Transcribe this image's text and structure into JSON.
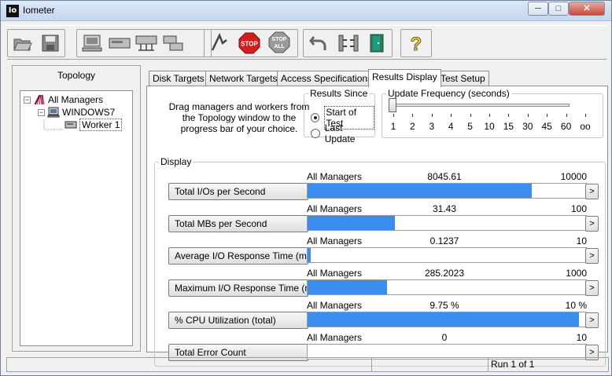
{
  "window": {
    "title": "Iometer",
    "icon": "io-app-icon",
    "min_label": "─",
    "max_label": "□",
    "close_label": "✕"
  },
  "toolbar": {
    "buttons": [
      {
        "icon": "open-icon"
      },
      {
        "icon": "save-icon"
      },
      {
        "icon": "display-window-icon"
      },
      {
        "icon": "new-disk-worker-icon"
      },
      {
        "icon": "new-network-worker-icon"
      },
      {
        "icon": "duplicate-worker-icon"
      },
      {
        "icon": "start-tests-icon"
      },
      {
        "icon": "stop-icon",
        "label": "STOP"
      },
      {
        "icon": "stop-all-icon",
        "label": "STOP ALL"
      },
      {
        "icon": "reset-workers-icon"
      },
      {
        "icon": "disconnect-manager-icon"
      },
      {
        "icon": "exit-icon"
      },
      {
        "icon": "help-icon",
        "label": "?"
      }
    ]
  },
  "topology": {
    "header": "Topology",
    "root": "All Managers",
    "manager": "WINDOWS7",
    "worker": "Worker 1",
    "expand_glyph": "−"
  },
  "tabs": [
    "Disk Targets",
    "Network Targets",
    "Access Specifications",
    "Results Display",
    "Test Setup"
  ],
  "active_tab": "Results Display",
  "drag_note": "Drag managers and workers from the Topology window to the progress bar of your choice.",
  "results_since": {
    "title": "Results Since",
    "options": [
      "Start of Test",
      "Last Update"
    ],
    "selected": "Start of Test"
  },
  "update_frequency": {
    "title": "Update Frequency (seconds)",
    "ticks": [
      "1",
      "2",
      "3",
      "4",
      "5",
      "10",
      "15",
      "30",
      "45",
      "60",
      "oo"
    ],
    "selected": "1"
  },
  "display": {
    "title": "Display",
    "more_label": ">",
    "metrics": [
      {
        "label": "Total I/Os per Second",
        "manager": "All Managers",
        "value": "8045.61",
        "max": "10000",
        "fraction": 0.8046
      },
      {
        "label": "Total MBs per Second",
        "manager": "All Managers",
        "value": "31.43",
        "max": "100",
        "fraction": 0.3143
      },
      {
        "label": "Average I/O Response Time (ms)",
        "manager": "All Managers",
        "value": "0.1237",
        "max": "10",
        "fraction": 0.0124
      },
      {
        "label": "Maximum I/O Response Time (ms)",
        "manager": "All Managers",
        "value": "285.2023",
        "max": "1000",
        "fraction": 0.2852
      },
      {
        "label": "% CPU Utilization (total)",
        "manager": "All Managers",
        "value": "9.75 %",
        "max": "10 %",
        "fraction": 0.975
      },
      {
        "label": "Total Error Count",
        "manager": "All Managers",
        "value": "0",
        "max": "10",
        "fraction": 0
      }
    ]
  },
  "status": {
    "cell1": "",
    "cell2": "",
    "run": "Run 1 of 1"
  },
  "colors": {
    "bar": "#3b8ef0",
    "window_frame": "#6f7f95",
    "stop_red": "#d41e1e"
  }
}
